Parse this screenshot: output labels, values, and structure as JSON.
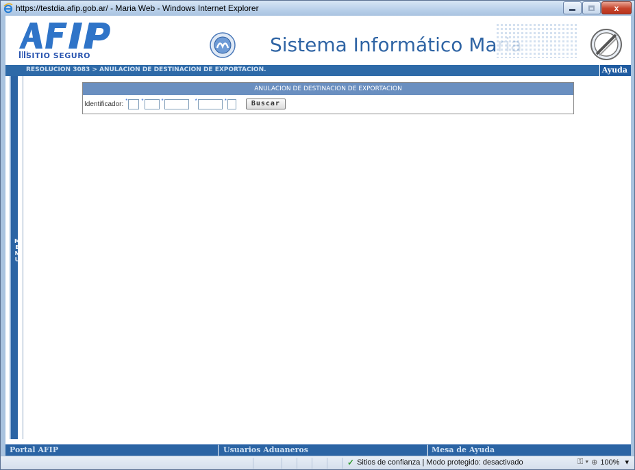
{
  "window": {
    "title": "https://testdia.afip.gob.ar/ - Maria Web - Windows Internet Explorer",
    "close_glyph": "x"
  },
  "header": {
    "logo_subtext": "SITIO SEGURO",
    "system_title": "Sistema Informático Maria"
  },
  "breadcrumb": {
    "path": "RESOLUCION 3083 > ANULACION DE DESTINACION DE EXPORTACION.",
    "help_label": "Ayuda"
  },
  "sidebar": {
    "menu_label": "M\nE\nN\nU"
  },
  "panel": {
    "title": "ANULACION DE DESTINACION DE EXPORTACION",
    "id_label": "Identificador:",
    "required_marker": "*",
    "fields": [
      {
        "value": ""
      },
      {
        "value": ""
      },
      {
        "value": ""
      },
      {
        "value": ""
      },
      {
        "value": ""
      }
    ],
    "search_button": "Buscar"
  },
  "footer": {
    "links": [
      "Portal AFIP",
      "Usuarios Aduaneros",
      "Mesa de Ayuda"
    ]
  },
  "statusbar": {
    "zone_text": "Sitios de confianza | Modo protegido: desactivado",
    "zoom": "100%"
  },
  "colors": {
    "header_blue": "#2f64a4",
    "bar_blue": "#2e6aa8",
    "panel_header": "#6a8fc0"
  }
}
